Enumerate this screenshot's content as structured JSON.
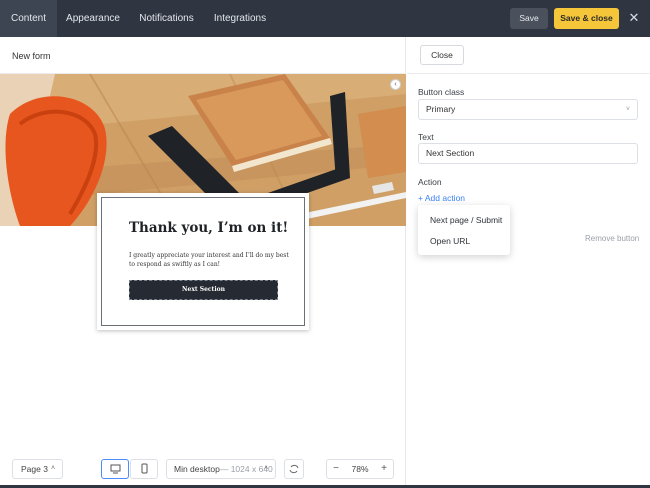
{
  "header": {
    "tabs": [
      {
        "label": "Content",
        "active": true
      },
      {
        "label": "Appearance",
        "active": false
      },
      {
        "label": "Notifications",
        "active": false
      },
      {
        "label": "Integrations",
        "active": false
      }
    ],
    "save_label": "Save",
    "save_close_label": "Save & close",
    "close_icon": "close-icon",
    "close_glyph": "✕"
  },
  "editor": {
    "form_name": "New form",
    "card": {
      "title": "Thank you,  I’m on it!",
      "body": "I greatly appreciate your interest and I’ll do my best to respond as swiftly as I can!",
      "button_label": "Next Section"
    }
  },
  "toolbar": {
    "page_label": "Page 3",
    "viewport_label": "Min desktop",
    "viewport_size": "— 1024 x 640",
    "zoom_value": "78%",
    "zoom_minus": "−",
    "zoom_plus": "+"
  },
  "panel": {
    "close_label": "Close",
    "button_class_label": "Button class",
    "button_class_value": "Primary",
    "text_label": "Text",
    "text_value": "Next Section",
    "action_label": "Action",
    "add_action_label": "+ Add action",
    "remove_button_label": "Remove button",
    "menu_items": [
      "Next page / Submit",
      "Open URL"
    ]
  },
  "colors": {
    "topbar": "#2f3541",
    "accent_yellow": "#f5c53a",
    "link_blue": "#3b82f6"
  }
}
